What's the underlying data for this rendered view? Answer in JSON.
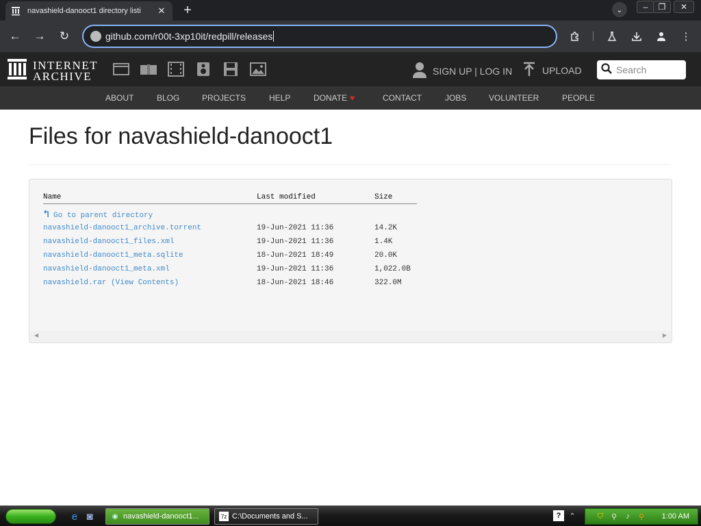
{
  "browser": {
    "tab_title": "navashield-danooct1 directory listi",
    "url": "github.com/r00t-3xp10it/redpill/releases",
    "colors": {
      "accent": "#8ab4f8",
      "chrome": "#35363a",
      "tab_strip": "#202124"
    }
  },
  "ia": {
    "logo_line1": "INTERNET",
    "logo_line2": "ARCHIVE",
    "user_link": "SIGN UP | LOG IN",
    "upload_label": "UPLOAD",
    "search_placeholder": "Search",
    "media_icons": [
      "web-icon",
      "texts-icon",
      "video-icon",
      "audio-icon",
      "software-icon",
      "images-icon"
    ],
    "subnav": [
      "ABOUT",
      "BLOG",
      "PROJECTS",
      "HELP",
      "DONATE",
      "CONTACT",
      "JOBS",
      "VOLUNTEER",
      "PEOPLE"
    ]
  },
  "page": {
    "title": "Files for navashield-danooct1",
    "table": {
      "headers": {
        "name": "Name",
        "modified": "Last modified",
        "size": "Size"
      },
      "parent_link": "Go to parent directory",
      "rows": [
        {
          "name": "navashield-danooct1_archive.torrent",
          "modified": "19-Jun-2021 11:36",
          "size": "14.2K"
        },
        {
          "name": "navashield-danooct1_files.xml",
          "modified": "19-Jun-2021 11:36",
          "size": "1.4K"
        },
        {
          "name": "navashield-danooct1_meta.sqlite",
          "modified": "18-Jun-2021 18:49",
          "size": "20.0K"
        },
        {
          "name": "navashield-danooct1_meta.xml",
          "modified": "19-Jun-2021 11:36",
          "size": "1,022.0B"
        },
        {
          "name": "navashield.rar",
          "extra": "(View Contents)",
          "modified": "18-Jun-2021 18:46",
          "size": "322.0M"
        }
      ]
    }
  },
  "taskbar": {
    "tasks": [
      "navashield-danooct1...",
      "C:\\Documents and S..."
    ],
    "clock": "1:00 AM"
  }
}
